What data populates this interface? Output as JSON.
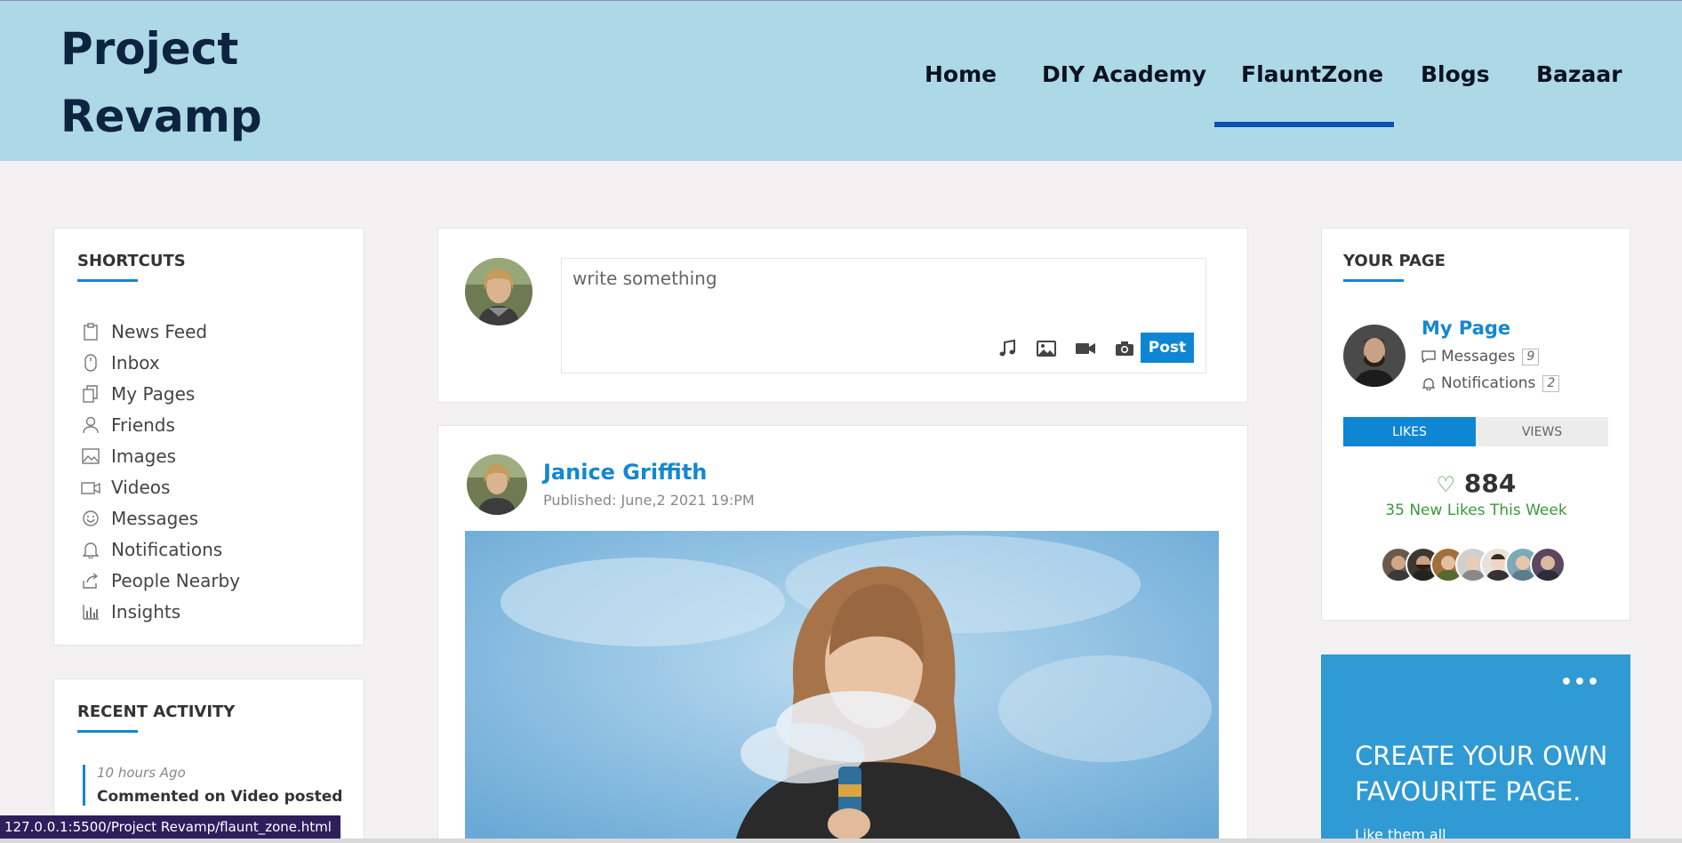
{
  "header": {
    "brand_line1": "Project",
    "brand_line2": "Revamp",
    "nav": [
      {
        "label": "Home"
      },
      {
        "label": "DIY Academy"
      },
      {
        "label": "FlauntZone"
      },
      {
        "label": "Blogs"
      },
      {
        "label": "Bazaar"
      }
    ],
    "active_nav": "FlauntZone"
  },
  "shortcuts": {
    "title": "SHORTCUTS",
    "items": [
      {
        "label": "News Feed",
        "icon": "clipboard-icon"
      },
      {
        "label": "Inbox",
        "icon": "mouse-icon"
      },
      {
        "label": "My Pages",
        "icon": "copy-pages-icon"
      },
      {
        "label": "Friends",
        "icon": "user-icon"
      },
      {
        "label": "Images",
        "icon": "image-icon"
      },
      {
        "label": "Videos",
        "icon": "video-camera-icon"
      },
      {
        "label": "Messages",
        "icon": "smiley-chat-icon"
      },
      {
        "label": "Notifications",
        "icon": "bell-icon"
      },
      {
        "label": "People Nearby",
        "icon": "share-icon"
      },
      {
        "label": "Insights",
        "icon": "bar-chart-icon"
      }
    ]
  },
  "recent_activity": {
    "title": "RECENT ACTIVITY",
    "items": [
      {
        "time": "10 hours Ago",
        "text": "Commented on Video posted"
      }
    ]
  },
  "composer": {
    "placeholder": "write something",
    "tools": [
      "music-icon",
      "image-icon",
      "video-icon",
      "camera-icon"
    ],
    "post_label": "Post"
  },
  "post": {
    "author": "Janice Griffith",
    "published": "Published: June,2 2021 19:PM"
  },
  "your_page": {
    "title": "YOUR PAGE",
    "page_name": "My Page",
    "messages_label": "Messages",
    "messages_count": "9",
    "notifications_label": "Notifications",
    "notifications_count": "2",
    "tabs": [
      "LIKES",
      "VIEWS"
    ],
    "likes": "884",
    "likes_week": "35 New Likes This Week"
  },
  "cta": {
    "title_line1": "CREATE YOUR OWN",
    "title_line2": "FAVOURITE PAGE.",
    "subtitle": "Like them all"
  },
  "status_url": "127.0.0.1:5500/Project Revamp/flaunt_zone.html",
  "colors": {
    "header_bg": "#add8e6",
    "accent": "#1487cf",
    "nav_active": "#0f4fb0",
    "cta_bg": "#2f9ad3"
  }
}
